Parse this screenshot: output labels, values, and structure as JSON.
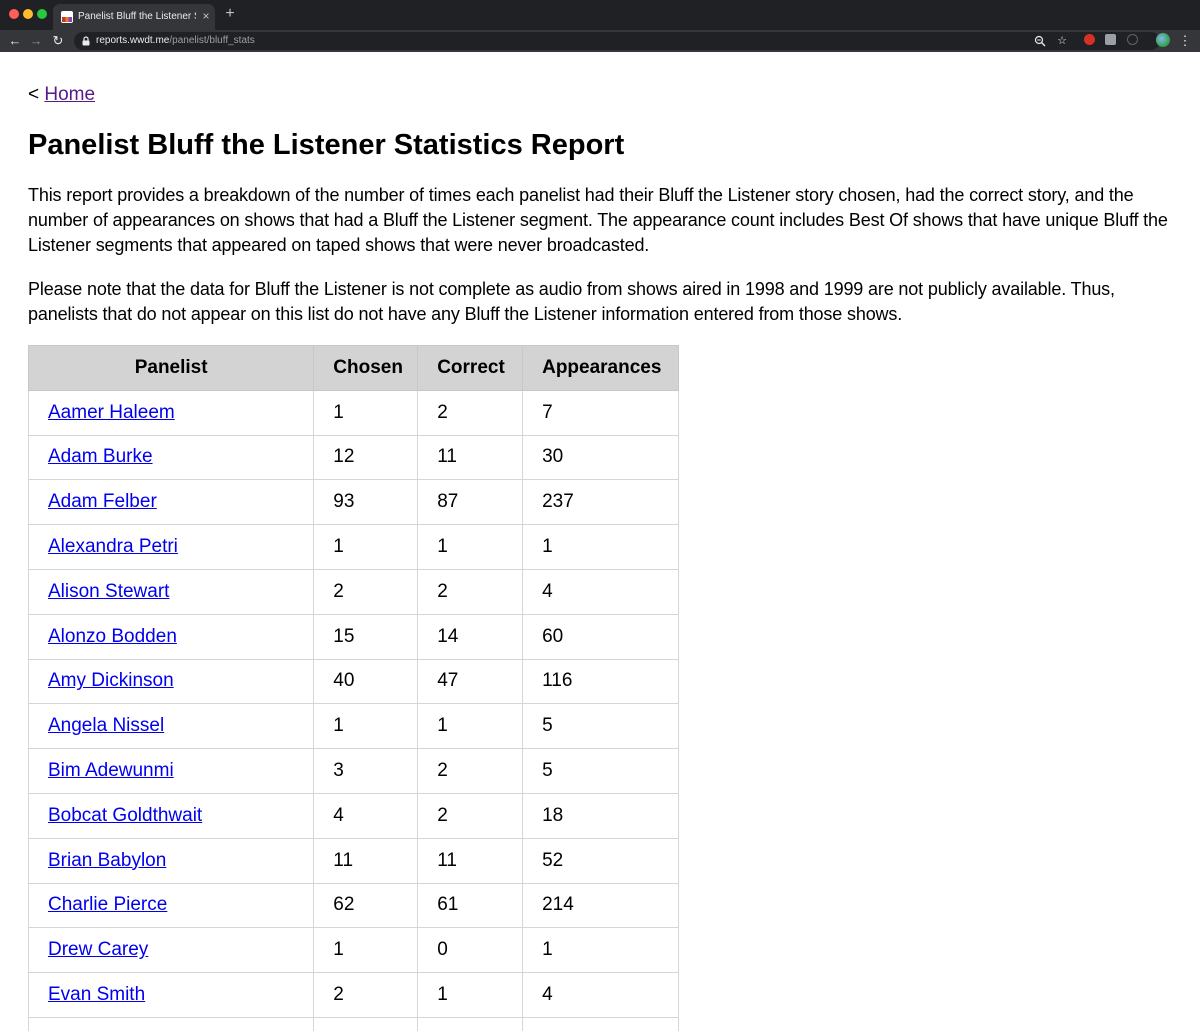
{
  "browser": {
    "tab_title": "Panelist Bluff the Listener Stati",
    "tab_close": "×",
    "new_tab": "+",
    "back": "←",
    "forward": "→",
    "reload": "↻",
    "url_host": "reports.wwdt.me",
    "url_path": "/panelist/bluff_stats",
    "menu": "⋮"
  },
  "page": {
    "crumb_prefix": "< ",
    "home_link": "Home",
    "title": "Panelist Bluff the Listener Statistics Report",
    "intro": "This report provides a breakdown of the number of times each panelist had their Bluff the Listener story chosen, had the correct story, and the number of appearances on shows that had a Bluff the Listener segment. The appearance count includes Best Of shows that have unique Bluff the Listener segments that appeared on taped shows that were never broadcasted.",
    "note": "Please note that the data for Bluff the Listener is not complete as audio from shows aired in 1998 and 1999 are not publicly available. Thus, panelists that do not appear on this list do not have any Bluff the Listener information entered from those shows."
  },
  "table": {
    "headers": {
      "panelist": "Panelist",
      "chosen": "Chosen",
      "correct": "Correct",
      "appearances": "Appearances"
    },
    "rows": [
      {
        "panelist": "Aamer Haleem",
        "chosen": "1",
        "correct": "2",
        "appearances": "7"
      },
      {
        "panelist": "Adam Burke",
        "chosen": "12",
        "correct": "11",
        "appearances": "30"
      },
      {
        "panelist": "Adam Felber",
        "chosen": "93",
        "correct": "87",
        "appearances": "237"
      },
      {
        "panelist": "Alexandra Petri",
        "chosen": "1",
        "correct": "1",
        "appearances": "1"
      },
      {
        "panelist": "Alison Stewart",
        "chosen": "2",
        "correct": "2",
        "appearances": "4"
      },
      {
        "panelist": "Alonzo Bodden",
        "chosen": "15",
        "correct": "14",
        "appearances": "60"
      },
      {
        "panelist": "Amy Dickinson",
        "chosen": "40",
        "correct": "47",
        "appearances": "116"
      },
      {
        "panelist": "Angela Nissel",
        "chosen": "1",
        "correct": "1",
        "appearances": "5"
      },
      {
        "panelist": "Bim Adewunmi",
        "chosen": "3",
        "correct": "2",
        "appearances": "5"
      },
      {
        "panelist": "Bobcat Goldthwait",
        "chosen": "4",
        "correct": "2",
        "appearances": "18"
      },
      {
        "panelist": "Brian Babylon",
        "chosen": "11",
        "correct": "11",
        "appearances": "52"
      },
      {
        "panelist": "Charlie Pierce",
        "chosen": "62",
        "correct": "61",
        "appearances": "214"
      },
      {
        "panelist": "Drew Carey",
        "chosen": "1",
        "correct": "0",
        "appearances": "1"
      },
      {
        "panelist": "Evan Smith",
        "chosen": "2",
        "correct": "1",
        "appearances": "4"
      },
      {
        "panelist": "",
        "chosen": "",
        "correct": "",
        "appearances": ""
      }
    ]
  }
}
